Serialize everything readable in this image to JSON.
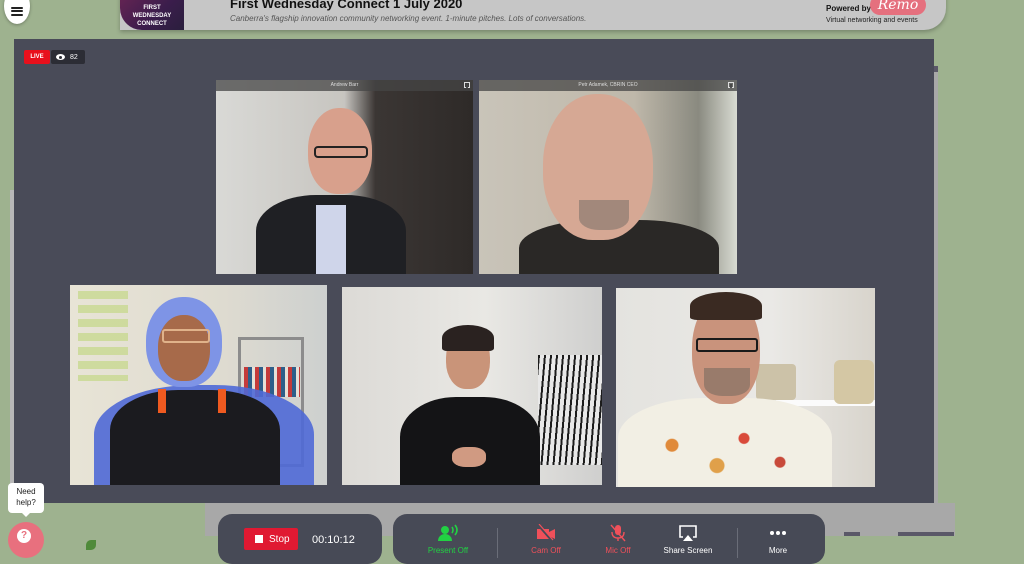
{
  "header": {
    "event_logo_lines": [
      "FIRST",
      "WEDNESDAY",
      "CONNECT"
    ],
    "event_title": "First Wednesday Connect 1 July 2020",
    "event_subtitle": "Canberra's flagship innovation community networking event. 1-minute pitches. Lots of conversations.",
    "powered_by": "Powered by",
    "brand_name": "Remo",
    "brand_tagline": "Virtual networking and events",
    "brand_color": "#e5707e"
  },
  "stage": {
    "live_label": "LIVE",
    "viewer_count": "82",
    "tiles": [
      {
        "name": "Andrew Barr"
      },
      {
        "name": "Petr Adamek, CBRIN CEO"
      },
      {
        "name": ""
      },
      {
        "name": ""
      },
      {
        "name": ""
      }
    ]
  },
  "controls": {
    "stop_label": "Stop",
    "timer": "00:10:12",
    "items": [
      {
        "label": "Present Off",
        "icon": "presenter-icon",
        "color": "#22d143"
      },
      {
        "label": "Cam Off",
        "icon": "camera-off-icon",
        "color": "#f0505a"
      },
      {
        "label": "Mic Off",
        "icon": "mic-off-icon",
        "color": "#f0505a"
      },
      {
        "label": "Share Screen",
        "icon": "share-screen-icon",
        "color": "#ffffff"
      },
      {
        "label": "More",
        "icon": "more-icon",
        "color": "#ffffff"
      }
    ]
  },
  "help": {
    "bubble_text_line1": "Need",
    "bubble_text_line2": "help?",
    "button_glyph": "?"
  }
}
